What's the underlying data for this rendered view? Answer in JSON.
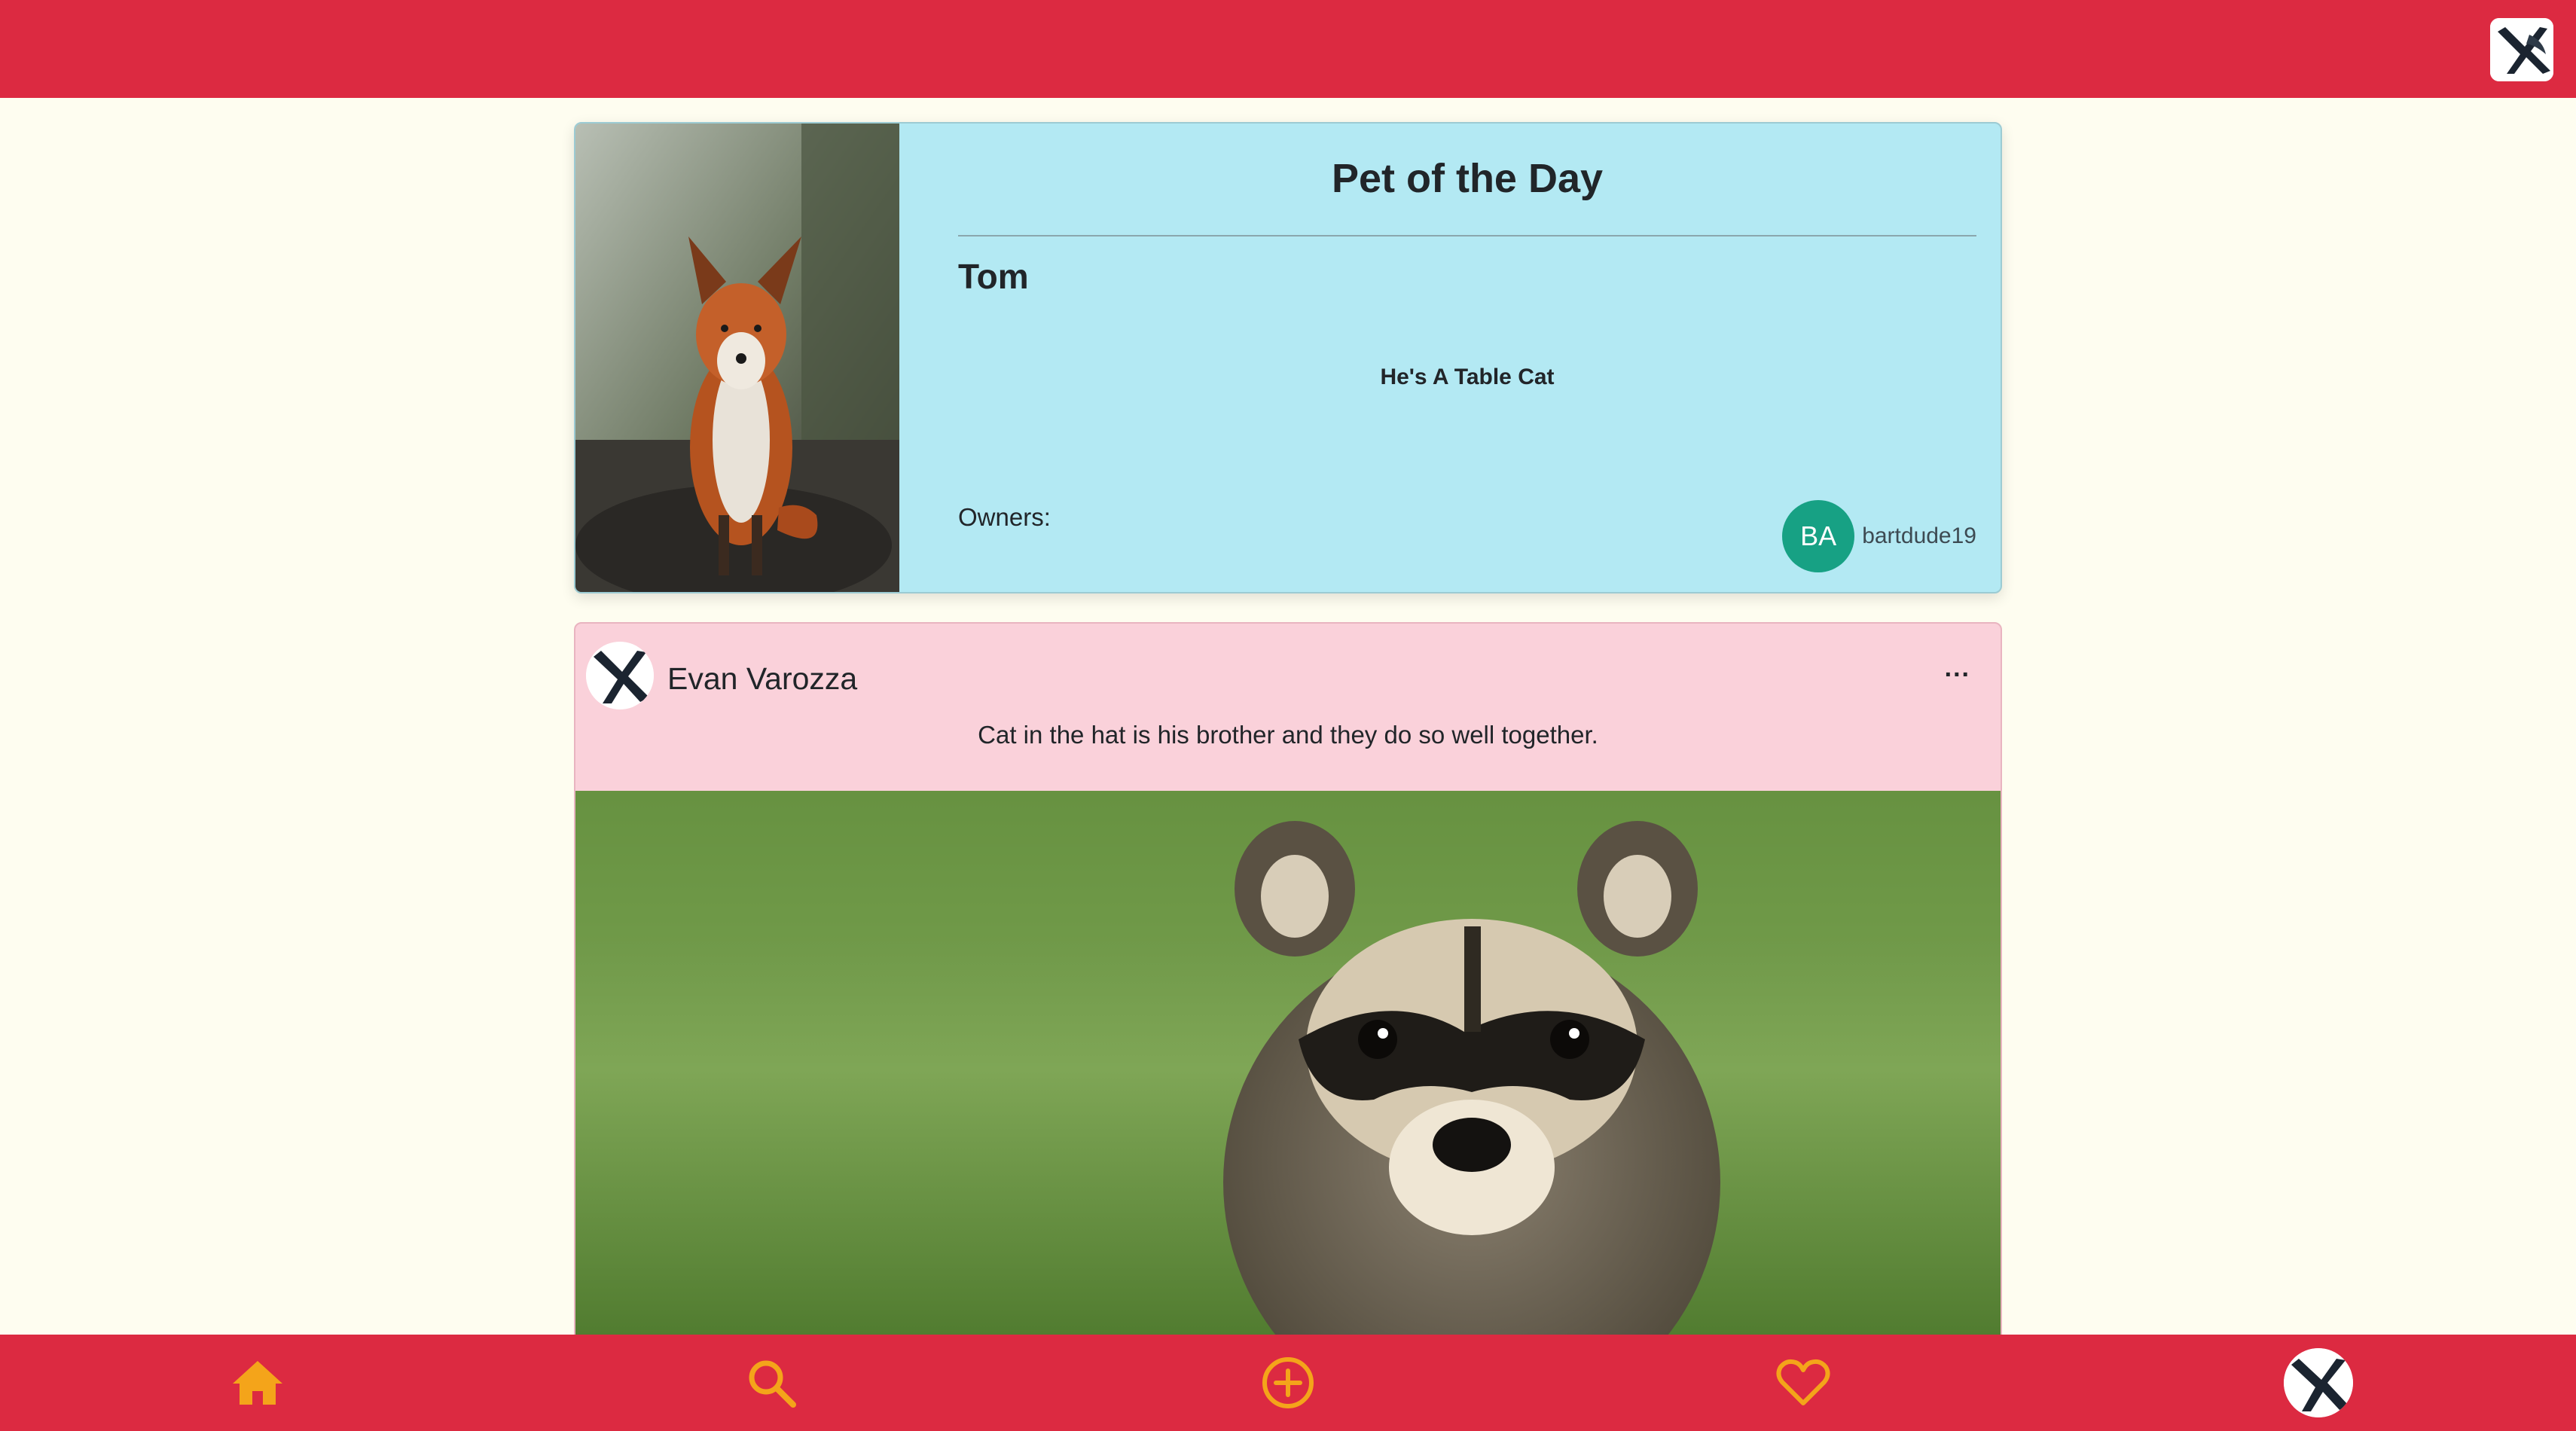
{
  "potd": {
    "heading": "Pet of the Day",
    "pet_name": "Tom",
    "bio": "He's A Table Cat",
    "owners_label": "Owners:",
    "owner": {
      "initials": "BA",
      "username": "bartdude19",
      "badge_color": "#17a184"
    }
  },
  "post": {
    "author": "Evan Varozza",
    "menu_label": "...",
    "caption": "Cat in the hat is his brother and they do so well together."
  },
  "nav": {
    "icons": [
      "home-icon",
      "search-icon",
      "add-circle-icon",
      "heart-icon",
      "profile-avatar"
    ],
    "accent": "#f4a41a"
  },
  "colors": {
    "bar": "#dc2a41",
    "page_bg": "#fefdf0",
    "potd_bg": "#b3e9f3",
    "post_bg": "#fad1da"
  }
}
